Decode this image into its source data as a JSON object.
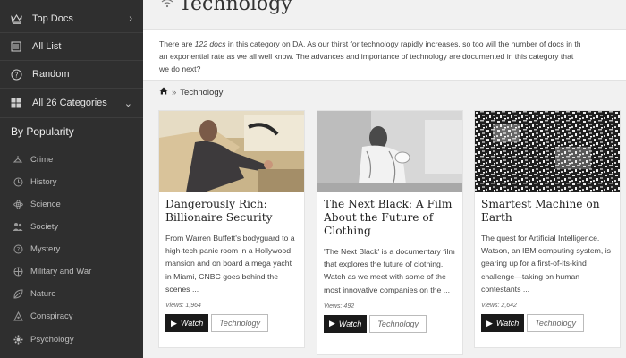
{
  "sidebar": {
    "top_items": [
      {
        "label": "Top Docs",
        "icon": "crown-icon",
        "chevron": "›"
      },
      {
        "label": "All List",
        "icon": "list-icon"
      },
      {
        "label": "Random",
        "icon": "question-circle-icon"
      },
      {
        "label": "All 26 Categories",
        "icon": "grid-icon",
        "chevron": "⌄"
      }
    ],
    "section_title": "By Popularity",
    "categories": [
      {
        "label": "Crime",
        "icon": "crime-icon"
      },
      {
        "label": "History",
        "icon": "history-icon"
      },
      {
        "label": "Science",
        "icon": "science-icon"
      },
      {
        "label": "Society",
        "icon": "society-icon"
      },
      {
        "label": "Mystery",
        "icon": "mystery-icon"
      },
      {
        "label": "Military and War",
        "icon": "military-icon"
      },
      {
        "label": "Nature",
        "icon": "nature-icon"
      },
      {
        "label": "Conspiracy",
        "icon": "conspiracy-icon"
      },
      {
        "label": "Psychology",
        "icon": "psychology-icon"
      }
    ]
  },
  "header": {
    "title": "Technology"
  },
  "intro": {
    "line1_pre": "There are ",
    "line1_em": "122 docs",
    "line1_post": " in this category on DA. As our thirst for technology rapidly increases, so too will the number of docs in th",
    "line2": "an exponential rate as we all well know. The advances and importance of technology are documented in this category that",
    "line3": "we do next?"
  },
  "breadcrumb": {
    "separator": "»",
    "current": "Technology"
  },
  "cards": [
    {
      "title": "Dangerously Rich: Billionaire Security",
      "description": "From Warren Buffett's bodyguard to a high-tech panic room in a Hollywood mansion and on board a mega yacht in Miami, CNBC goes behind the scenes ...",
      "views": "Views: 1,964",
      "watch_label": "Watch",
      "tag": "Technology"
    },
    {
      "title": "The Next Black: A Film About the Future of Clothing",
      "description": "'The Next Black' is a documentary film that explores the future of clothing. Watch as we meet with some of the most innovative companies on the ...",
      "views": "Views: 492",
      "watch_label": "Watch",
      "tag": "Technology"
    },
    {
      "title": "Smartest Machine on Earth",
      "description": "The quest for Artificial Intelligence. Watson, an IBM computing system, is gearing up for a first-of-its-kind challenge—taking on human contestants ...",
      "views": "Views: 2,642",
      "watch_label": "Watch",
      "tag": "Technology"
    }
  ],
  "colors": {
    "sidebar_bg": "#2f2f2f",
    "watch_bg": "#1a1a1a",
    "page_bg": "#f1f1f1"
  }
}
